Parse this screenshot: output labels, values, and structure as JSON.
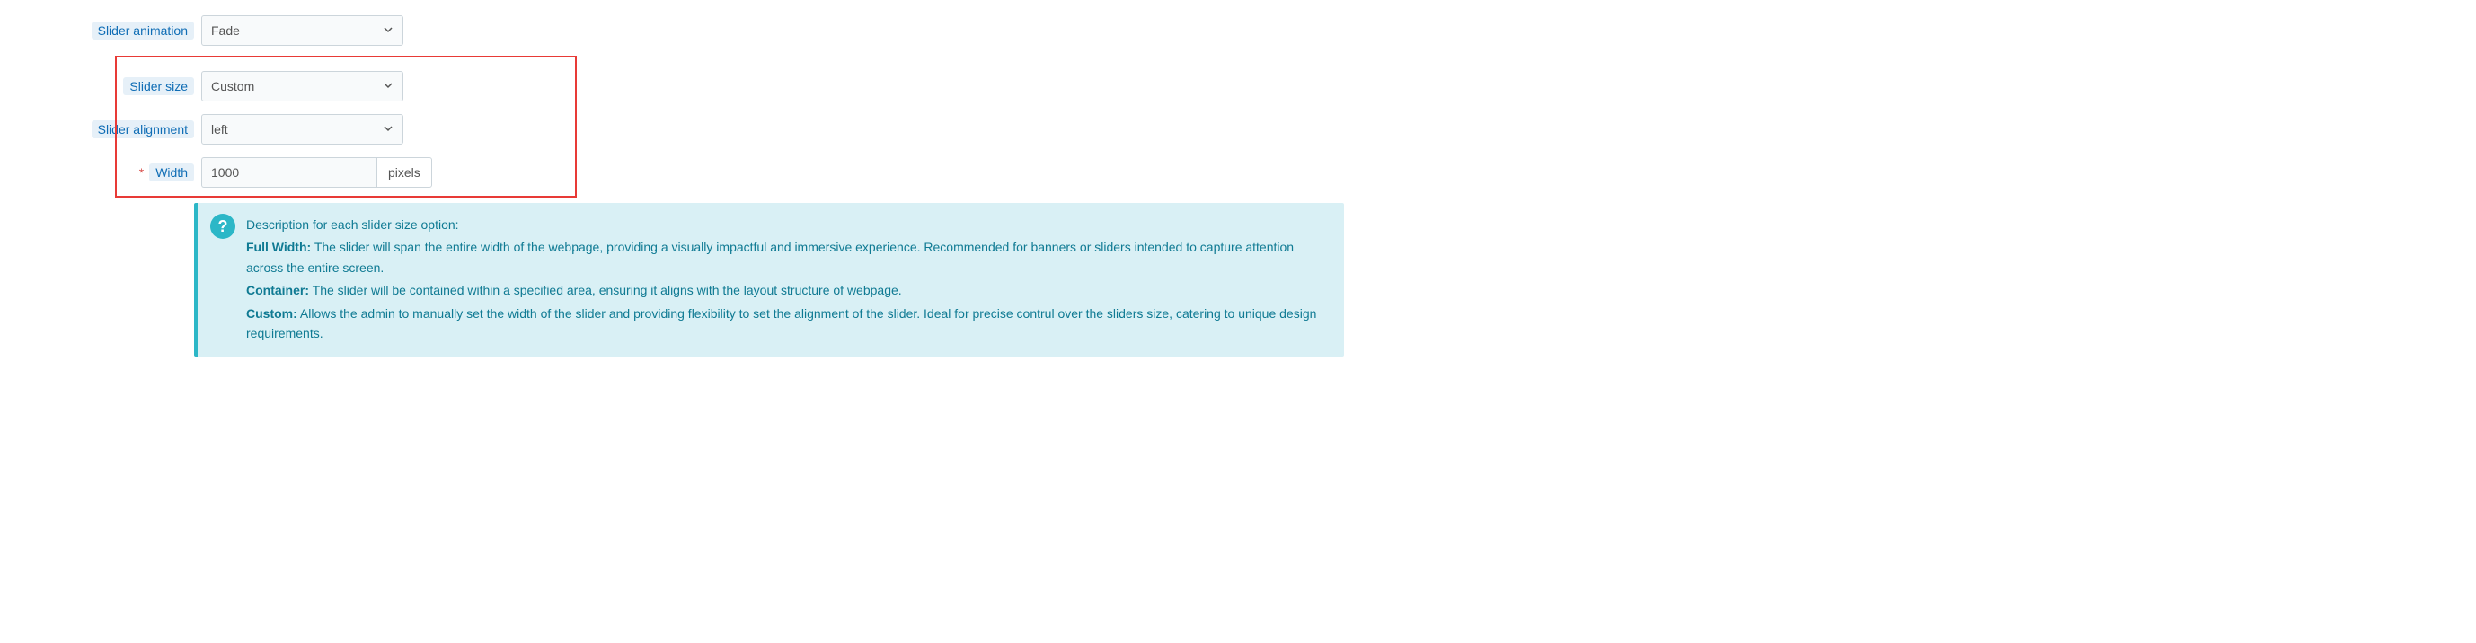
{
  "form": {
    "anim": {
      "label": "Slider animation",
      "value": "Fade"
    },
    "size": {
      "label": "Slider size",
      "value": "Custom"
    },
    "align": {
      "label": "Slider alignment",
      "value": "left"
    },
    "width": {
      "label": "Width",
      "value": "1000",
      "unit": "pixels",
      "required": "*"
    }
  },
  "tip": {
    "intro": "Description for each slider size option:",
    "full_t": "Full Width:",
    "full_b": " The slider will span the entire width of the webpage, providing a visually impactful and immersive experience. Recommended for banners or sliders intended to capture attention across the entire screen.",
    "cont_t": "Container:",
    "cont_b": " The slider will be contained within a specified area, ensuring it aligns with the layout structure of webpage.",
    "cust_t": "Custom:",
    "cust_b": " Allows the admin to manually set the width of the slider and providing flexibility to set the alignment of the slider. Ideal for precise contrul over the sliders size, catering to unique design requirements."
  }
}
